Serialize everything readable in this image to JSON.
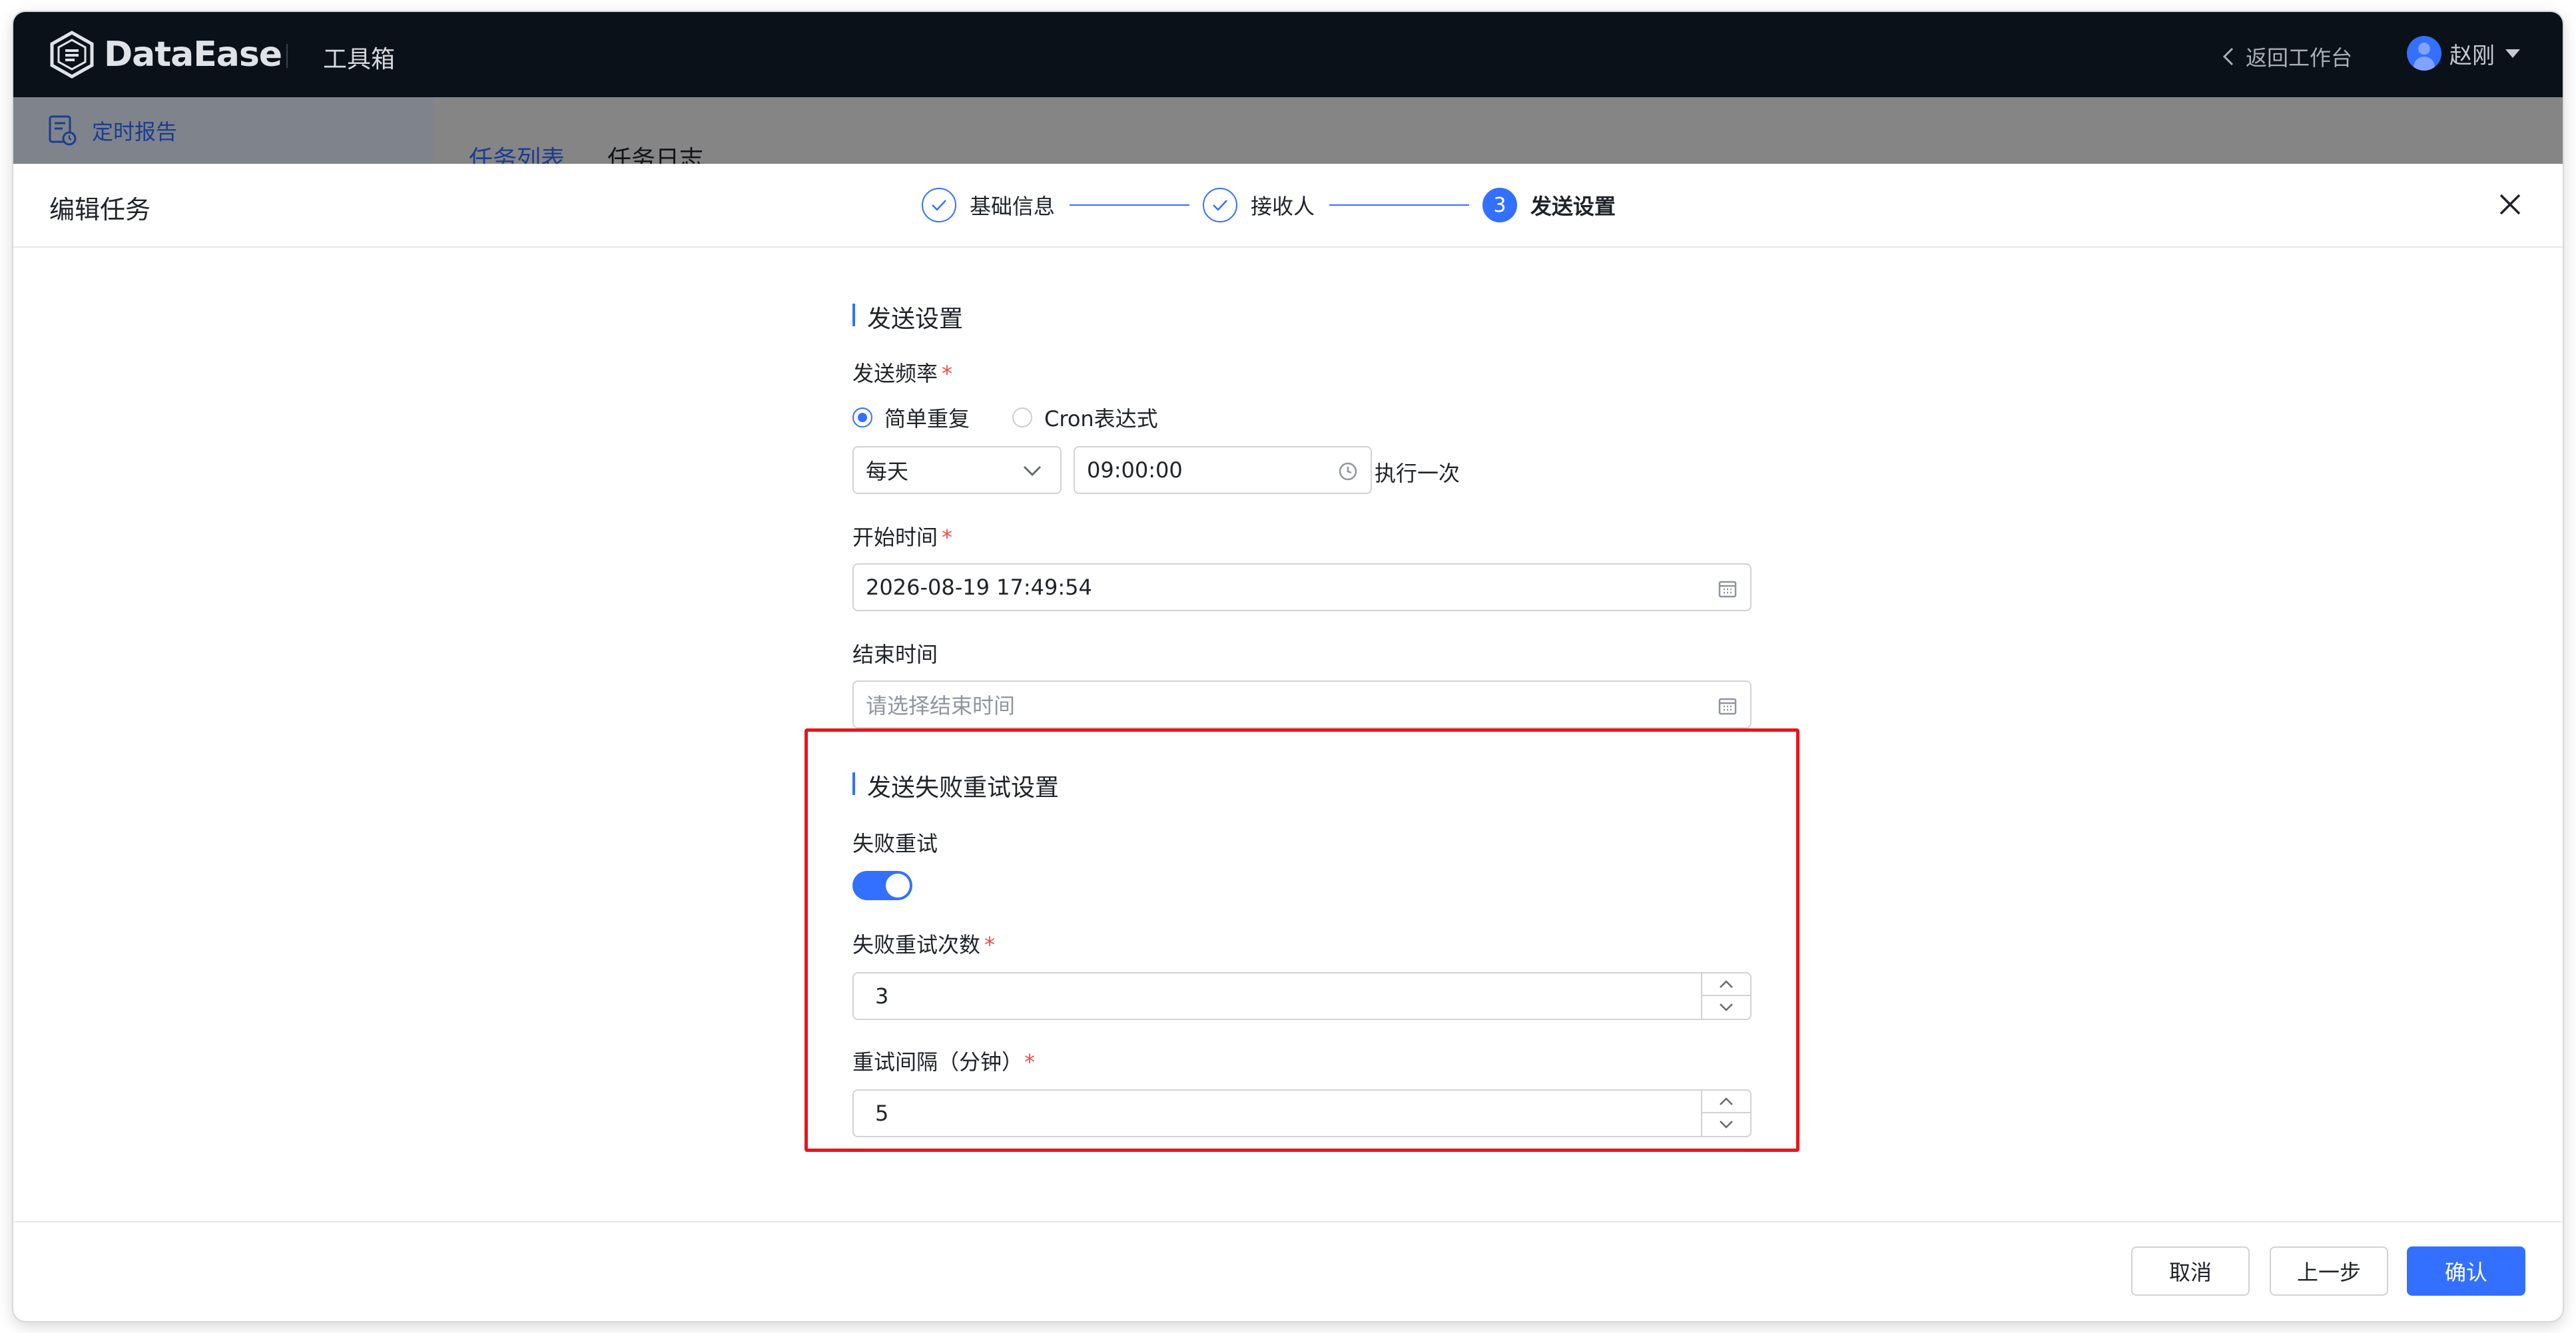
{
  "app": {
    "brand": "DataEase",
    "toolbox": "工具箱",
    "back_to_workbench": "返回工作台",
    "user_name": "赵刚"
  },
  "background_page": {
    "sidebar_item": "定时报告",
    "tabs": [
      "任务列表",
      "任务日志"
    ]
  },
  "drawer": {
    "title": "编辑任务",
    "steps": [
      {
        "label": "基础信息",
        "state": "done"
      },
      {
        "label": "接收人",
        "state": "done"
      },
      {
        "number": "3",
        "label": "发送设置",
        "state": "current"
      }
    ]
  },
  "send_settings": {
    "section_title": "发送设置",
    "frequency_label": "发送频率",
    "required_mark": "*",
    "frequency_options": [
      {
        "label": "简单重复",
        "selected": true
      },
      {
        "label": "Cron表达式",
        "selected": false
      }
    ],
    "repeat_period": "每天",
    "repeat_time": "09:00:00",
    "repeat_suffix": "执行一次",
    "start_time_label": "开始时间",
    "start_time_value": "2026-08-19 17:49:54",
    "end_time_label": "结束时间",
    "end_time_placeholder": "请选择结束时间"
  },
  "retry_settings": {
    "section_title": "发送失败重试设置",
    "retry_label": "失败重试",
    "retry_enabled": true,
    "retry_count_label": "失败重试次数",
    "retry_count_value": "3",
    "retry_interval_label": "重试间隔（分钟）",
    "retry_interval_value": "5"
  },
  "footer": {
    "cancel": "取消",
    "previous": "上一步",
    "confirm": "确认"
  },
  "colors": {
    "accent": "#3370ff",
    "highlight": "#e8151a",
    "topbar": "#0b1118"
  }
}
